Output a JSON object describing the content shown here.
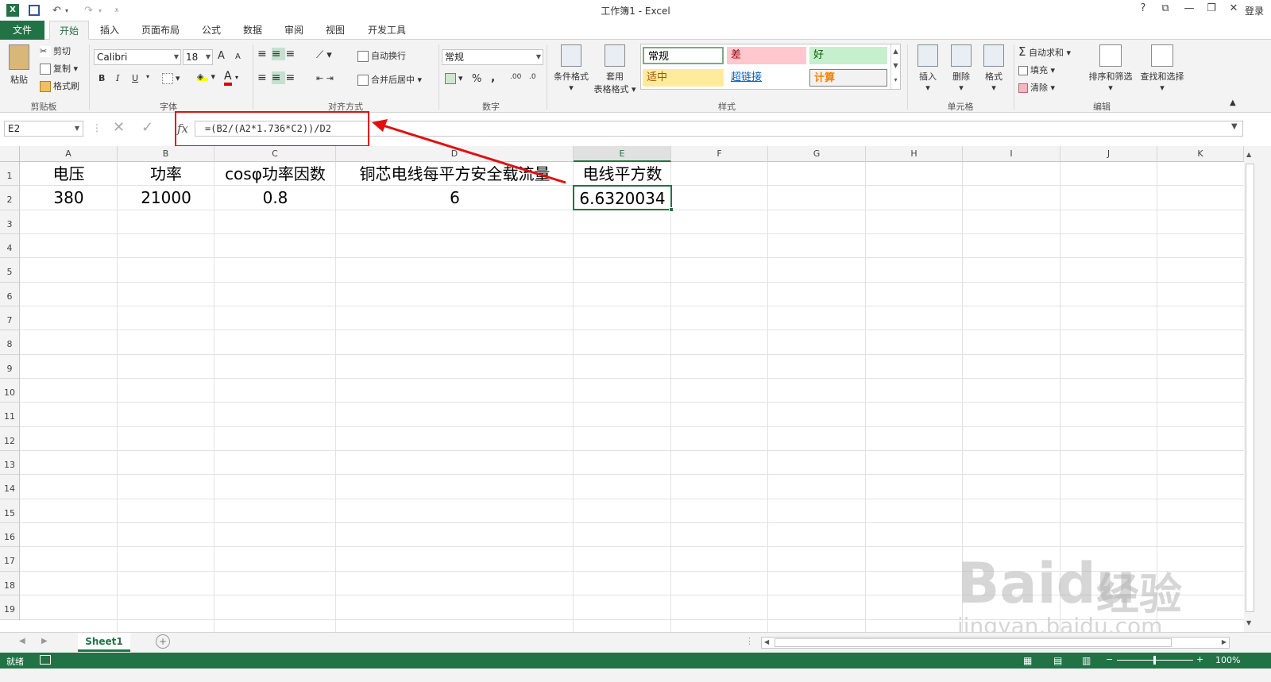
{
  "titlebar": {
    "title": "工作簿1 - Excel",
    "undo": "↶",
    "redo": "↷",
    "help": "?",
    "restore_ribbon": "⧉",
    "minimize": "—",
    "maximize": "❐",
    "close": "✕",
    "signin": "登录"
  },
  "tabs": [
    {
      "label": "文件"
    },
    {
      "label": "开始"
    },
    {
      "label": "插入"
    },
    {
      "label": "页面布局"
    },
    {
      "label": "公式"
    },
    {
      "label": "数据"
    },
    {
      "label": "审阅"
    },
    {
      "label": "视图"
    },
    {
      "label": "开发工具"
    }
  ],
  "ribbon": {
    "clipboard": {
      "paste": "粘贴",
      "cut": "剪切",
      "copy": "复制",
      "format_painter": "格式刷",
      "label": "剪贴板"
    },
    "font": {
      "name": "Calibri",
      "size": "18",
      "grow": "A",
      "shrink": "A",
      "bold": "B",
      "italic": "I",
      "underline": "U",
      "font_color": "A",
      "label": "字体"
    },
    "alignment": {
      "wrap": "自动换行",
      "merge": "合并后居中",
      "label": "对齐方式"
    },
    "number": {
      "format": "常规",
      "percent": "%",
      "comma": ",",
      "label": "数字"
    },
    "styles": {
      "conditional": "条件格式",
      "table_line1": "套用",
      "table_line2": "表格格式",
      "normal": "常规",
      "bad": "差",
      "good": "好",
      "neutral": "适中",
      "hyperlink": "超链接",
      "calc": "计算",
      "label": "样式"
    },
    "cells": {
      "insert": "插入",
      "delete": "删除",
      "format": "格式",
      "label": "单元格"
    },
    "editing": {
      "autosum": "自动求和",
      "fill": "填充",
      "clear": "清除",
      "sort": "排序和筛选",
      "find": "查找和选择",
      "label": "编辑"
    }
  },
  "formula_bar": {
    "name_box": "E2",
    "fx": "fx",
    "formula": "=(B2/(A2*1.736*C2))/D2"
  },
  "columns": [
    "A",
    "B",
    "C",
    "D",
    "E",
    "F",
    "G",
    "H",
    "I",
    "J",
    "K"
  ],
  "rows": [
    "1",
    "2",
    "3",
    "4",
    "5",
    "6",
    "7",
    "8",
    "9",
    "10",
    "11",
    "12",
    "13",
    "14",
    "15",
    "16",
    "17",
    "18",
    "19"
  ],
  "cells": {
    "A1": "电压",
    "B1": "功率",
    "C1": "cosφ功率因数",
    "D1": "铜芯电线每平方安全载流量",
    "E1": "电线平方数",
    "A2": "380",
    "B2": "21000",
    "C2": "0.8",
    "D2": "6",
    "E2": "6.6320034"
  },
  "sheet_tabs": [
    {
      "label": "Sheet1"
    }
  ],
  "status": {
    "ready": "就绪",
    "zoom": "100%"
  },
  "watermark": {
    "brand": "Baidu",
    "sub": "经验",
    "url": "jingyan.baidu.com"
  },
  "colors": {
    "excel_green": "#217346",
    "annotation_red": "#e01010"
  }
}
